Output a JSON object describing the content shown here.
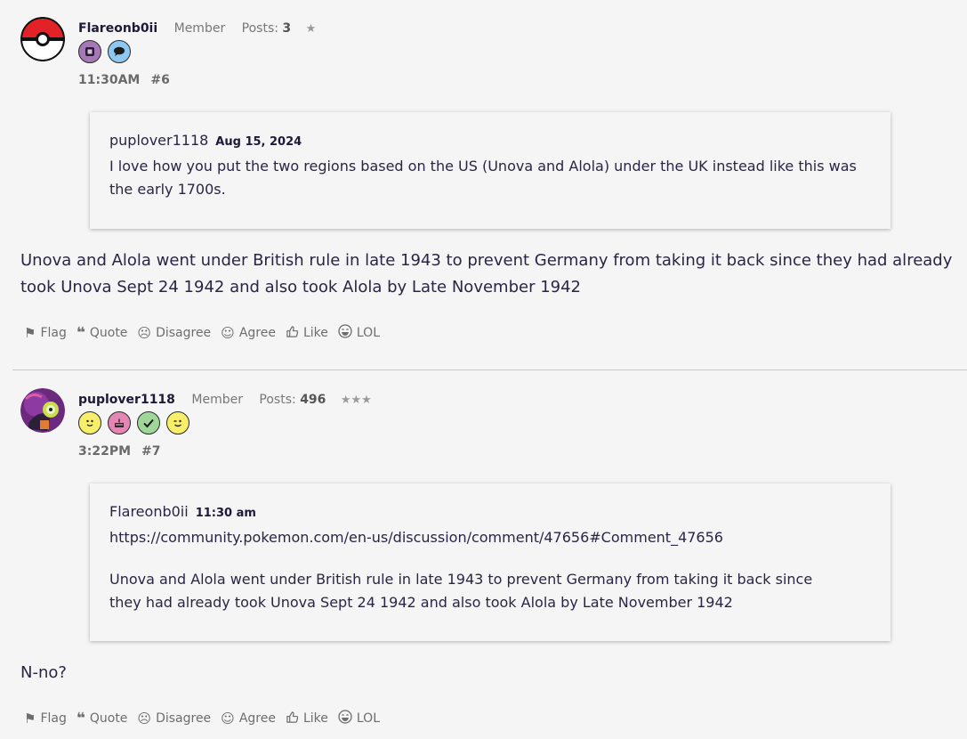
{
  "posts": [
    {
      "author": "Flareonb0ii",
      "role": "Member",
      "posts_label": "Posts:",
      "posts_count": "3",
      "stars": "★",
      "time": "11:30AM",
      "number": "#6",
      "badges": [
        "gem-badge-icon",
        "speech-bubble-badge-icon"
      ],
      "quote": {
        "author": "puplover1118",
        "date": "Aug 15, 2024",
        "paragraphs": [
          "I love how you put the two regions based on the US (Unova and Alola) under the UK instead like this was the early 1700s."
        ]
      },
      "body": "Unova and Alola went under British rule in late 1943 to prevent Germany from taking it back since they had already took Unova Sept 24 1942 and also took Alola by Late November 1942"
    },
    {
      "author": "puplover1118",
      "role": "Member",
      "posts_label": "Posts:",
      "posts_count": "496",
      "stars": "★★★",
      "time": "3:22PM",
      "number": "#7",
      "badges": [
        "smiley-badge-icon",
        "cake-badge-icon",
        "check-badge-icon",
        "wink-badge-icon"
      ],
      "quote": {
        "author": "Flareonb0ii",
        "date": "11:30 am",
        "paragraphs": [
          "https://community.pokemon.com/en-us/discussion/comment/47656#Comment_47656",
          "Unova and Alola went under British rule in late 1943 to prevent Germany from taking it back since they had already took Unova Sept 24 1942 and also took Alola by Late November 1942"
        ]
      },
      "body": "N-no?"
    }
  ],
  "actions": {
    "flag": "Flag",
    "quote": "Quote",
    "disagree": "Disagree",
    "agree": "Agree",
    "like": "Like",
    "lol": "LOL"
  },
  "colors": {
    "background": "#f5f5f5",
    "text": "#2a2545",
    "muted": "#6d6d6d"
  }
}
